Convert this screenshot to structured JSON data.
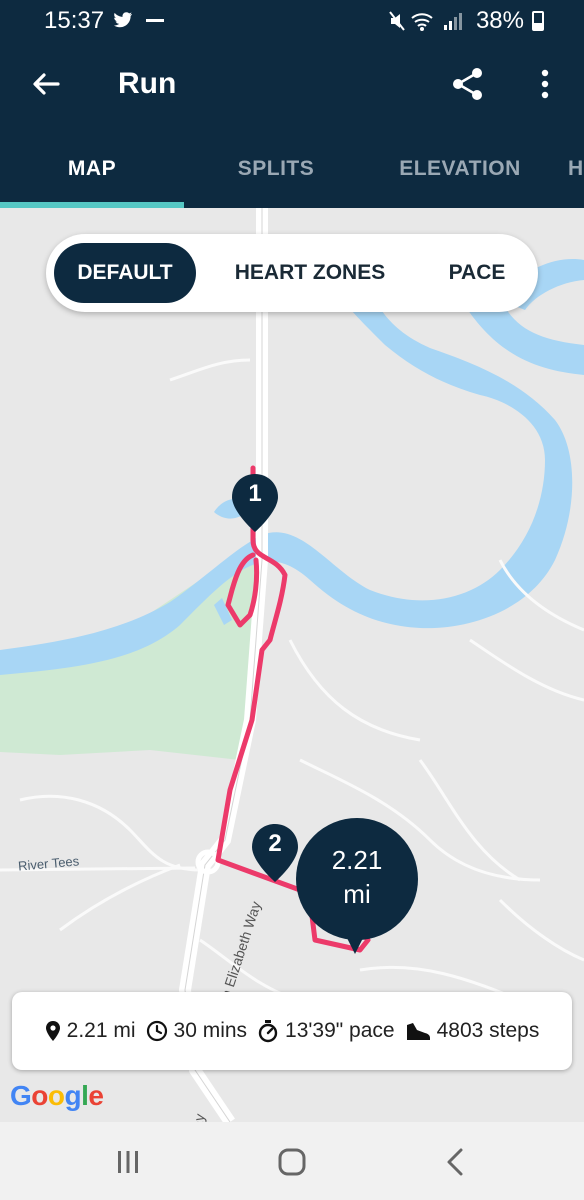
{
  "status_bar": {
    "time": "15:37",
    "battery": "38%",
    "left_icons": [
      "twitter-icon",
      "minus-icon"
    ],
    "right_icons": [
      "mute-icon",
      "wifi-icon",
      "signal-icon",
      "battery-icon"
    ]
  },
  "app_bar": {
    "title": "Run",
    "back_icon": "arrow-left-icon",
    "share_icon": "share-icon",
    "more_icon": "more-vertical-icon"
  },
  "tabs": [
    {
      "label": "MAP",
      "active": true
    },
    {
      "label": "SPLITS",
      "active": false
    },
    {
      "label": "ELEVATION",
      "active": false
    },
    {
      "label": "H",
      "active": false
    }
  ],
  "colors": {
    "primary": "#0d2a40",
    "accent": "#56c7c4",
    "route": "#ec3a6a",
    "water": "#a8d6f5",
    "park": "#cfe9d3"
  },
  "map_mode": {
    "options": [
      "DEFAULT",
      "HEART ZONES",
      "PACE"
    ],
    "selected": "DEFAULT"
  },
  "map": {
    "labels": {
      "river": "River Tees",
      "street_1": "Queen Elizabeth Way",
      "street_2": "Myton Way"
    },
    "markers": [
      "1",
      "2"
    ],
    "distance_value": "2.21",
    "distance_unit": "mi",
    "attribution": "Google"
  },
  "stats": {
    "distance": "2.21 mi",
    "duration": "30 mins",
    "pace": "13'39\" pace",
    "steps": "4803 steps"
  },
  "nav_bar": {
    "icons": [
      "recent-apps-icon",
      "home-icon",
      "back-icon"
    ]
  }
}
